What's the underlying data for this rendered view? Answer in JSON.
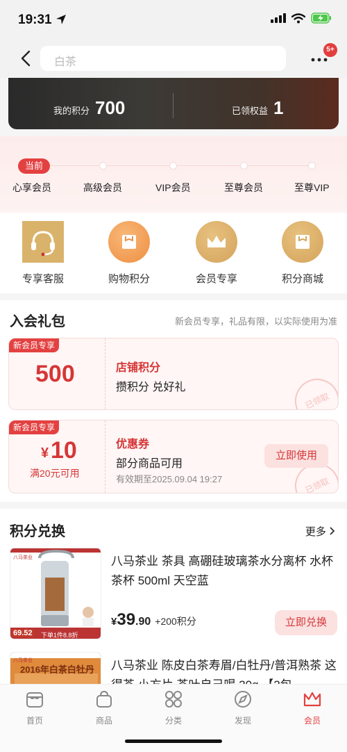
{
  "status": {
    "time": "19:31"
  },
  "nav": {
    "search_placeholder": "白茶",
    "badge": "5+"
  },
  "points_card": {
    "points_label": "我的积分",
    "points_value": "700",
    "rights_label": "已领权益",
    "rights_value": "1"
  },
  "levels": {
    "current_label": "当前",
    "items": [
      "心享会员",
      "高级会员",
      "VIP会员",
      "至尊会员",
      "至尊VIP"
    ]
  },
  "features": [
    "专享客服",
    "购物积分",
    "会员专享",
    "积分商城"
  ],
  "gift": {
    "title": "入会礼包",
    "note": "新会员专享，礼品有限，以实际使用为准",
    "coupons": [
      {
        "tag": "新会员专享",
        "value": "500",
        "title": "店铺积分",
        "subtitle": "攒积分 兑好礼",
        "stamp": "已领取"
      },
      {
        "tag": "新会员专享",
        "currency": "¥",
        "value": "10",
        "condition": "满20元可用",
        "title": "优惠券",
        "subtitle": "部分商品可用",
        "validity": "有效期至2025.09.04 19:27",
        "button": "立即使用",
        "stamp": "已领取"
      }
    ]
  },
  "exchange": {
    "title": "积分兑换",
    "more": "更多",
    "products": [
      {
        "title": "八马茶业 茶具 高硼硅玻璃茶水分离杯 水杯 茶杯 500ml 天空蓝",
        "price_yen": "¥",
        "price_int": "39",
        "price_dec": ".90",
        "points": "+200积分",
        "button": "立即兑换",
        "img_badge_price": "69.52",
        "img_badge_text": "下单1件8.8折",
        "img_brand": "八马茶业"
      },
      {
        "title": "八马茶业 陈皮白茶寿眉/白牡丹/普洱熟茶 这得茶 小方片 茶叶自己喝 20g 【2包",
        "img_text": "2016年白茶白牡丹",
        "img_brand": "八马茶业"
      }
    ]
  },
  "tabs": [
    {
      "label": "首页",
      "active": false
    },
    {
      "label": "商品",
      "active": false
    },
    {
      "label": "分类",
      "active": false
    },
    {
      "label": "发现",
      "active": false
    },
    {
      "label": "会员",
      "active": true
    }
  ],
  "colors": {
    "accent": "#e34141",
    "gold": "#d9b36b",
    "orange": "#f0a25a"
  }
}
